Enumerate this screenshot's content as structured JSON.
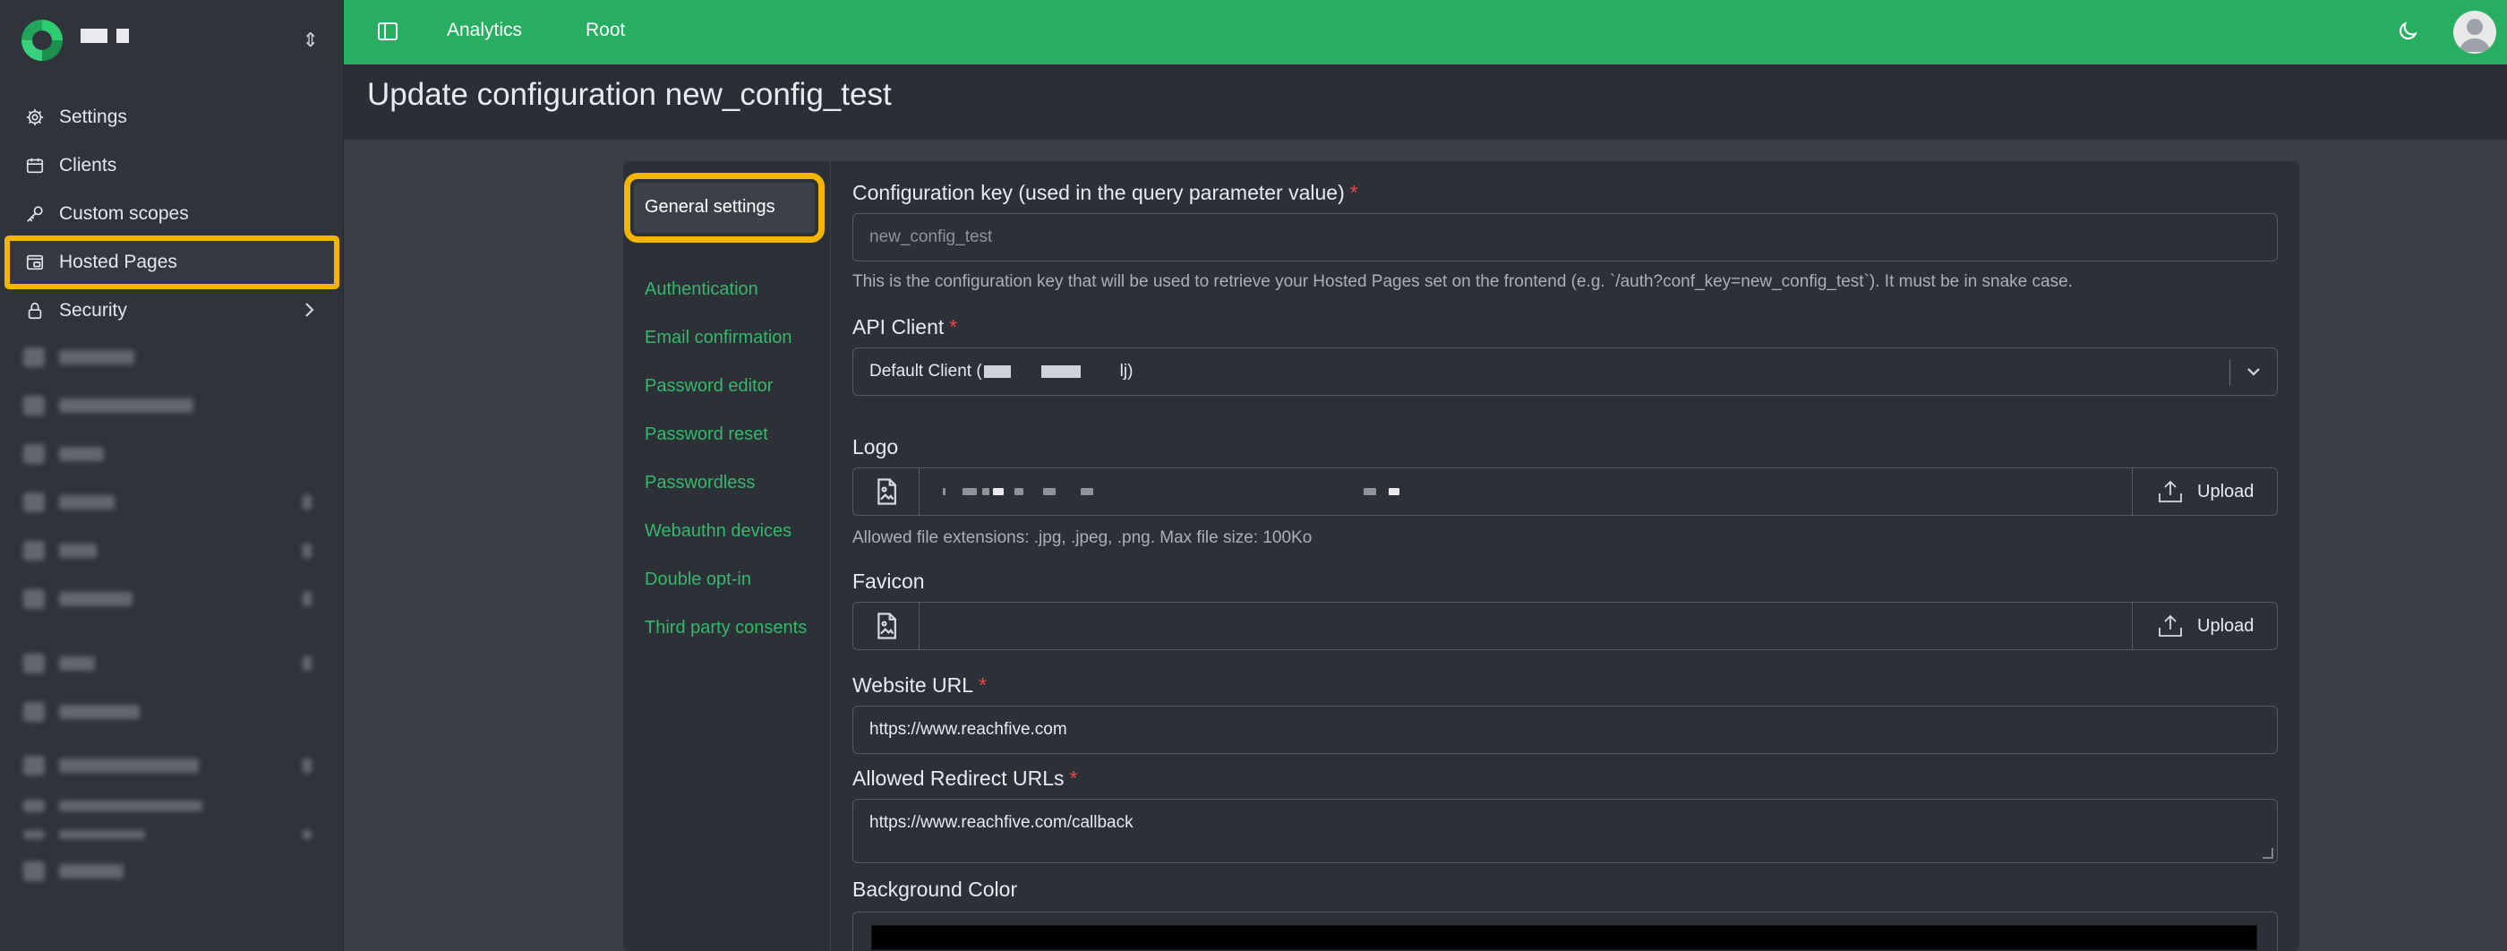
{
  "sidebar": {
    "items": [
      {
        "label": "Settings",
        "icon": "gear-icon"
      },
      {
        "label": "Clients",
        "icon": "calendar-window-icon"
      },
      {
        "label": "Custom scopes",
        "icon": "key-icon"
      },
      {
        "label": "Hosted Pages",
        "icon": "browser-window-icon"
      },
      {
        "label": "Security",
        "icon": "lock-icon"
      }
    ]
  },
  "topbar": {
    "links": [
      "Analytics",
      "Root"
    ]
  },
  "page": {
    "title": "Update configuration new_config_test"
  },
  "tabs": [
    "General settings",
    "Authentication",
    "Email confirmation",
    "Password editor",
    "Password reset",
    "Passwordless",
    "Webauthn devices",
    "Double opt-in",
    "Third party consents"
  ],
  "form": {
    "config_key": {
      "label": "Configuration key (used in the query parameter value)",
      "required": "*",
      "placeholder": "new_config_test",
      "help": "This is the configuration key that will be used to retrieve your Hosted Pages set on the frontend (e.g. `/auth?conf_key=new_config_test`). It must be in snake case."
    },
    "api_client": {
      "label": "API Client",
      "required": "*",
      "value_prefix": "Default Client (",
      "value_suffix": "lj)"
    },
    "logo": {
      "label": "Logo",
      "upload_label": "Upload",
      "help": "Allowed file extensions: .jpg, .jpeg, .png. Max file size: 100Ko"
    },
    "favicon": {
      "label": "Favicon",
      "upload_label": "Upload"
    },
    "website_url": {
      "label": "Website URL",
      "required": "*",
      "value": "https://www.reachfive.com"
    },
    "redirect_urls": {
      "label": "Allowed Redirect URLs",
      "required": "*",
      "value": "https://www.reachfive.com/callback"
    },
    "background_color": {
      "label": "Background Color",
      "value": "#000000"
    }
  },
  "colors": {
    "topbar": "#27ae60",
    "accent_green": "#35b86b",
    "highlight": "#f5b400",
    "required": "#e5484d"
  }
}
